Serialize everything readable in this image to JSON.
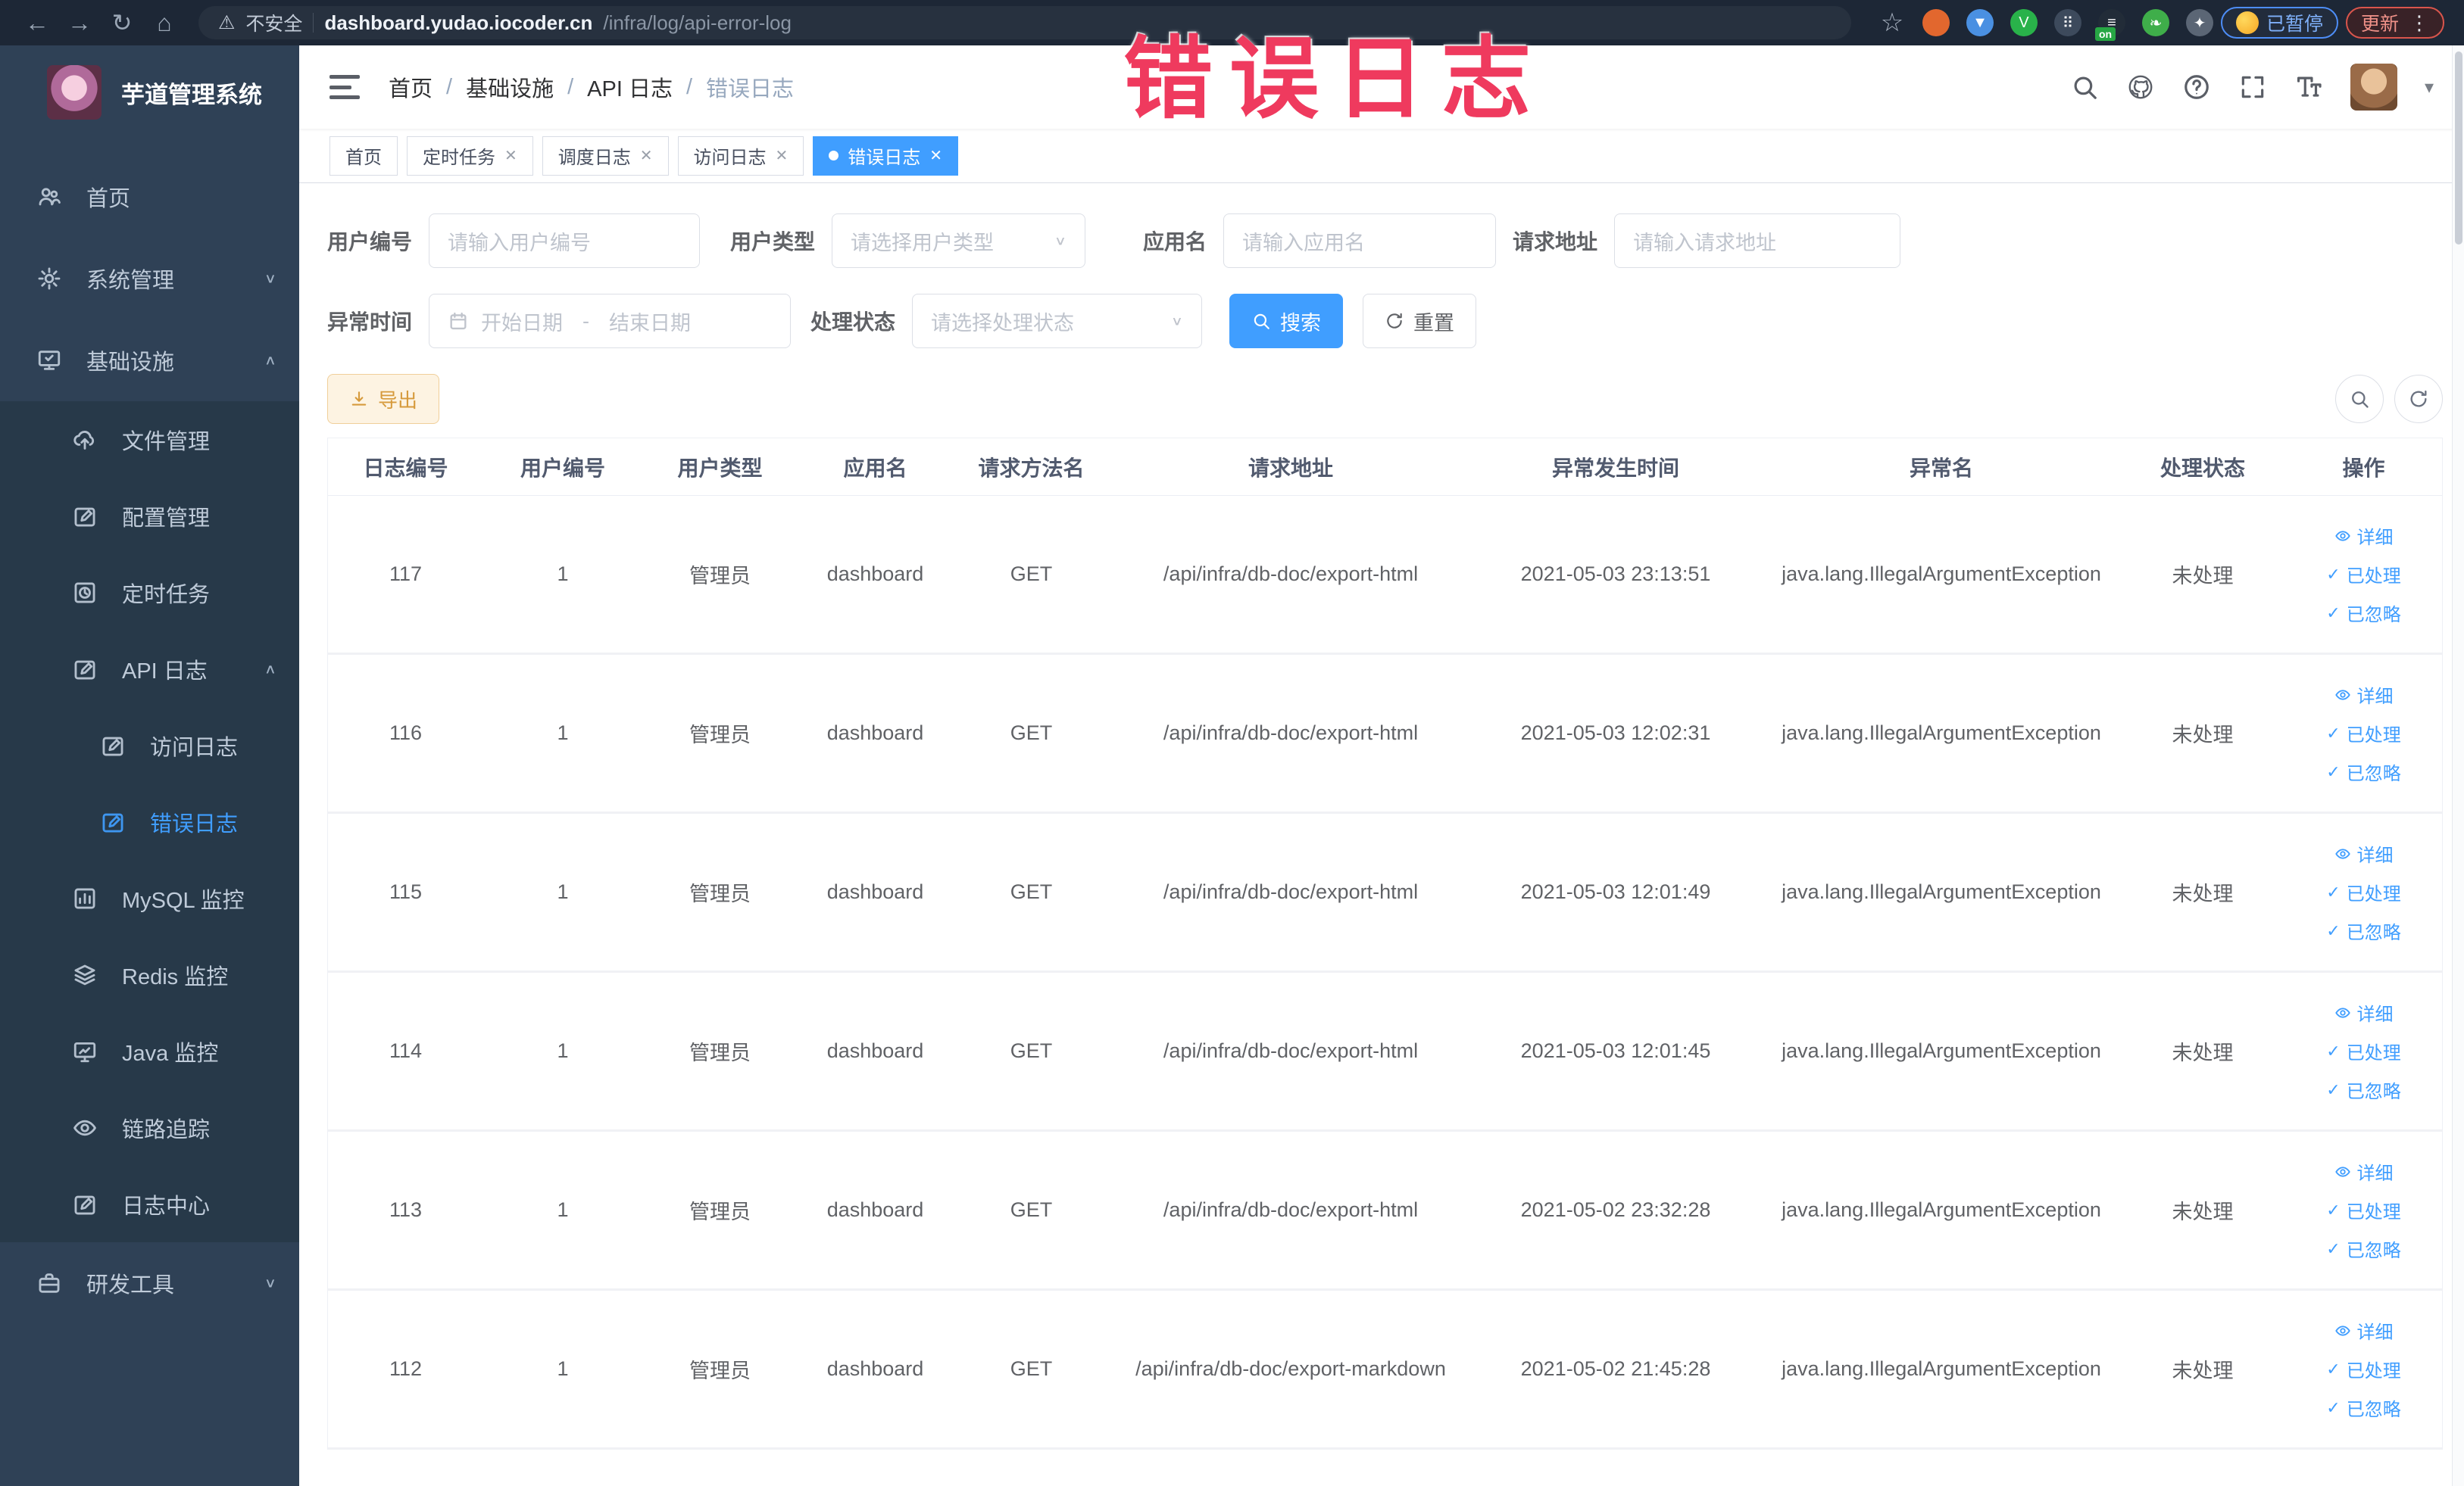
{
  "browser": {
    "security_label": "不安全",
    "url_host": "dashboard.yudao.iocoder.cn",
    "url_path": "/infra/log/api-error-log",
    "paused_badge": "已暂停",
    "update_badge": "更新",
    "extensions": [
      {
        "name": "bookmark-star-icon",
        "kind": "star",
        "color": "#aab4c2",
        "glyph": "☆"
      },
      {
        "name": "adblock-extension-icon",
        "kind": "circle",
        "color": "#e2672e",
        "glyph": ""
      },
      {
        "name": "shield-extension-icon",
        "kind": "circle",
        "color": "#4a90e2",
        "glyph": "▼"
      },
      {
        "name": "v-extension-icon",
        "kind": "circle",
        "color": "#29b24a",
        "glyph": "V"
      },
      {
        "name": "grid-extension-icon",
        "kind": "circle",
        "color": "#3d4a5c",
        "glyph": "⠿"
      },
      {
        "name": "switch-on-extension-icon",
        "kind": "circle",
        "color": "#222c38",
        "glyph": "≡",
        "badge": "on"
      },
      {
        "name": "leaf-extension-icon",
        "kind": "circle",
        "color": "#3fae4a",
        "glyph": "❧"
      },
      {
        "name": "puzzle-extension-icon",
        "kind": "circle",
        "color": "#5b6675",
        "glyph": "✦"
      }
    ]
  },
  "watermark": "错误日志",
  "sidebar": {
    "logo_title": "芋道管理系统",
    "items": [
      {
        "label": "首页",
        "icon": "people-icon",
        "level": 0
      },
      {
        "label": "系统管理",
        "icon": "gear-icon",
        "level": 0,
        "chevron": "down"
      },
      {
        "label": "基础设施",
        "icon": "infrastructure-monitor-icon",
        "level": 0,
        "chevron": "up"
      },
      {
        "label": "文件管理",
        "icon": "cloud-upload-icon",
        "level": 1
      },
      {
        "label": "配置管理",
        "icon": "edit-square-icon",
        "level": 1
      },
      {
        "label": "定时任务",
        "icon": "scheduled-task-icon",
        "level": 1
      },
      {
        "label": "API 日志",
        "icon": "api-log-icon",
        "level": 1,
        "chevron": "up"
      },
      {
        "label": "访问日志",
        "icon": "access-log-icon",
        "level": 2
      },
      {
        "label": "错误日志",
        "icon": "error-log-icon",
        "level": 2,
        "active": true
      },
      {
        "label": "MySQL 监控",
        "icon": "mysql-chart-icon",
        "level": 1
      },
      {
        "label": "Redis 监控",
        "icon": "redis-layers-icon",
        "level": 1
      },
      {
        "label": "Java 监控",
        "icon": "java-monitor-icon",
        "level": 1
      },
      {
        "label": "链路追踪",
        "icon": "trace-eye-icon",
        "level": 1
      },
      {
        "label": "日志中心",
        "icon": "log-center-icon",
        "level": 1
      },
      {
        "label": "研发工具",
        "icon": "dev-tools-icon",
        "level": 0,
        "chevron": "down"
      }
    ]
  },
  "breadcrumb": [
    "首页",
    "基础设施",
    "API 日志",
    "错误日志"
  ],
  "tabs": [
    {
      "label": "首页",
      "closable": false,
      "active": false
    },
    {
      "label": "定时任务",
      "closable": true,
      "active": false
    },
    {
      "label": "调度日志",
      "closable": true,
      "active": false
    },
    {
      "label": "访问日志",
      "closable": true,
      "active": false
    },
    {
      "label": "错误日志",
      "closable": true,
      "active": true
    }
  ],
  "filters": {
    "user_id_label": "用户编号",
    "user_id_placeholder": "请输入用户编号",
    "user_type_label": "用户类型",
    "user_type_placeholder": "请选择用户类型",
    "app_name_label": "应用名",
    "app_name_placeholder": "请输入应用名",
    "request_url_label": "请求地址",
    "request_url_placeholder": "请输入请求地址",
    "exception_time_label": "异常时间",
    "range_start_placeholder": "开始日期",
    "range_separator": "-",
    "range_end_placeholder": "结束日期",
    "process_status_label": "处理状态",
    "process_status_placeholder": "请选择处理状态",
    "search_label": "搜索",
    "reset_label": "重置"
  },
  "toolbar": {
    "export_label": "导出"
  },
  "table": {
    "columns": [
      "日志编号",
      "用户编号",
      "用户类型",
      "应用名",
      "请求方法名",
      "请求地址",
      "异常发生时间",
      "异常名",
      "处理状态",
      "操作"
    ],
    "action_labels": [
      "详细",
      "已处理",
      "已忽略"
    ],
    "rows": [
      {
        "id": "117",
        "user_id": "1",
        "user_type": "管理员",
        "app": "dashboard",
        "method": "GET",
        "url": "/api/infra/db-doc/export-html",
        "time": "2021-05-03 23:13:51",
        "exception": "java.lang.IllegalArgumentException",
        "status": "未处理"
      },
      {
        "id": "116",
        "user_id": "1",
        "user_type": "管理员",
        "app": "dashboard",
        "method": "GET",
        "url": "/api/infra/db-doc/export-html",
        "time": "2021-05-03 12:02:31",
        "exception": "java.lang.IllegalArgumentException",
        "status": "未处理"
      },
      {
        "id": "115",
        "user_id": "1",
        "user_type": "管理员",
        "app": "dashboard",
        "method": "GET",
        "url": "/api/infra/db-doc/export-html",
        "time": "2021-05-03 12:01:49",
        "exception": "java.lang.IllegalArgumentException",
        "status": "未处理"
      },
      {
        "id": "114",
        "user_id": "1",
        "user_type": "管理员",
        "app": "dashboard",
        "method": "GET",
        "url": "/api/infra/db-doc/export-html",
        "time": "2021-05-03 12:01:45",
        "exception": "java.lang.IllegalArgumentException",
        "status": "未处理"
      },
      {
        "id": "113",
        "user_id": "1",
        "user_type": "管理员",
        "app": "dashboard",
        "method": "GET",
        "url": "/api/infra/db-doc/export-html",
        "time": "2021-05-02 23:32:28",
        "exception": "java.lang.IllegalArgumentException",
        "status": "未处理"
      },
      {
        "id": "112",
        "user_id": "1",
        "user_type": "管理员",
        "app": "dashboard",
        "method": "GET",
        "url": "/api/infra/db-doc/export-markdown",
        "time": "2021-05-02 21:45:28",
        "exception": "java.lang.IllegalArgumentException",
        "status": "未处理"
      }
    ]
  },
  "colors": {
    "accent": "#409eff",
    "watermark": "#ef3a5e",
    "sidebar_bg": "#2f4156",
    "submenu_bg": "#273949",
    "warning_btn": "#d69a3c"
  }
}
